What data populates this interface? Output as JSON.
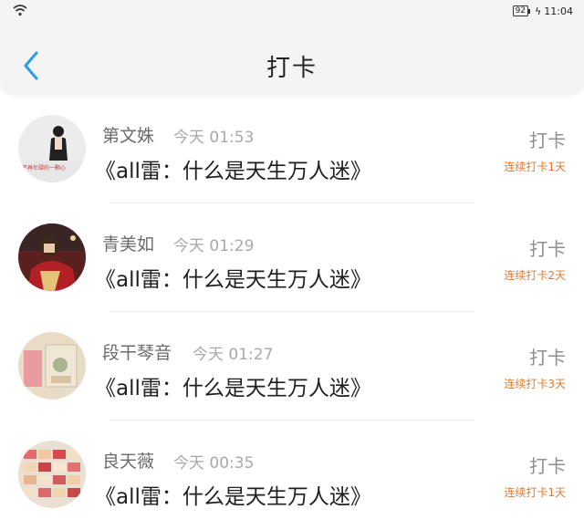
{
  "status_bar": {
    "battery": "92",
    "time": "11:04"
  },
  "header": {
    "title": "打卡"
  },
  "colors": {
    "accent": "#2b9be6",
    "streak": "#e2792f",
    "divider": "#ededed"
  },
  "items": [
    {
      "name": "第文姝",
      "time": "今天 01:53",
      "content": "《all雷：什么是天生万人迷》",
      "button": "打卡",
      "streak": "连续打卡1天",
      "avatar_caption": "不再忙碌的一颗心"
    },
    {
      "name": "青美如",
      "time": "今天 01:29",
      "content": "《all雷：什么是天生万人迷》",
      "button": "打卡",
      "streak": "连续打卡2天"
    },
    {
      "name": "段干琴音",
      "time": "今天 01:27",
      "content": "《all雷：什么是天生万人迷》",
      "button": "打卡",
      "streak": "连续打卡3天"
    },
    {
      "name": "良天薇",
      "time": "今天 00:35",
      "content": "《all雷：什么是天生万人迷》",
      "button": "打卡",
      "streak": "连续打卡1天"
    }
  ]
}
